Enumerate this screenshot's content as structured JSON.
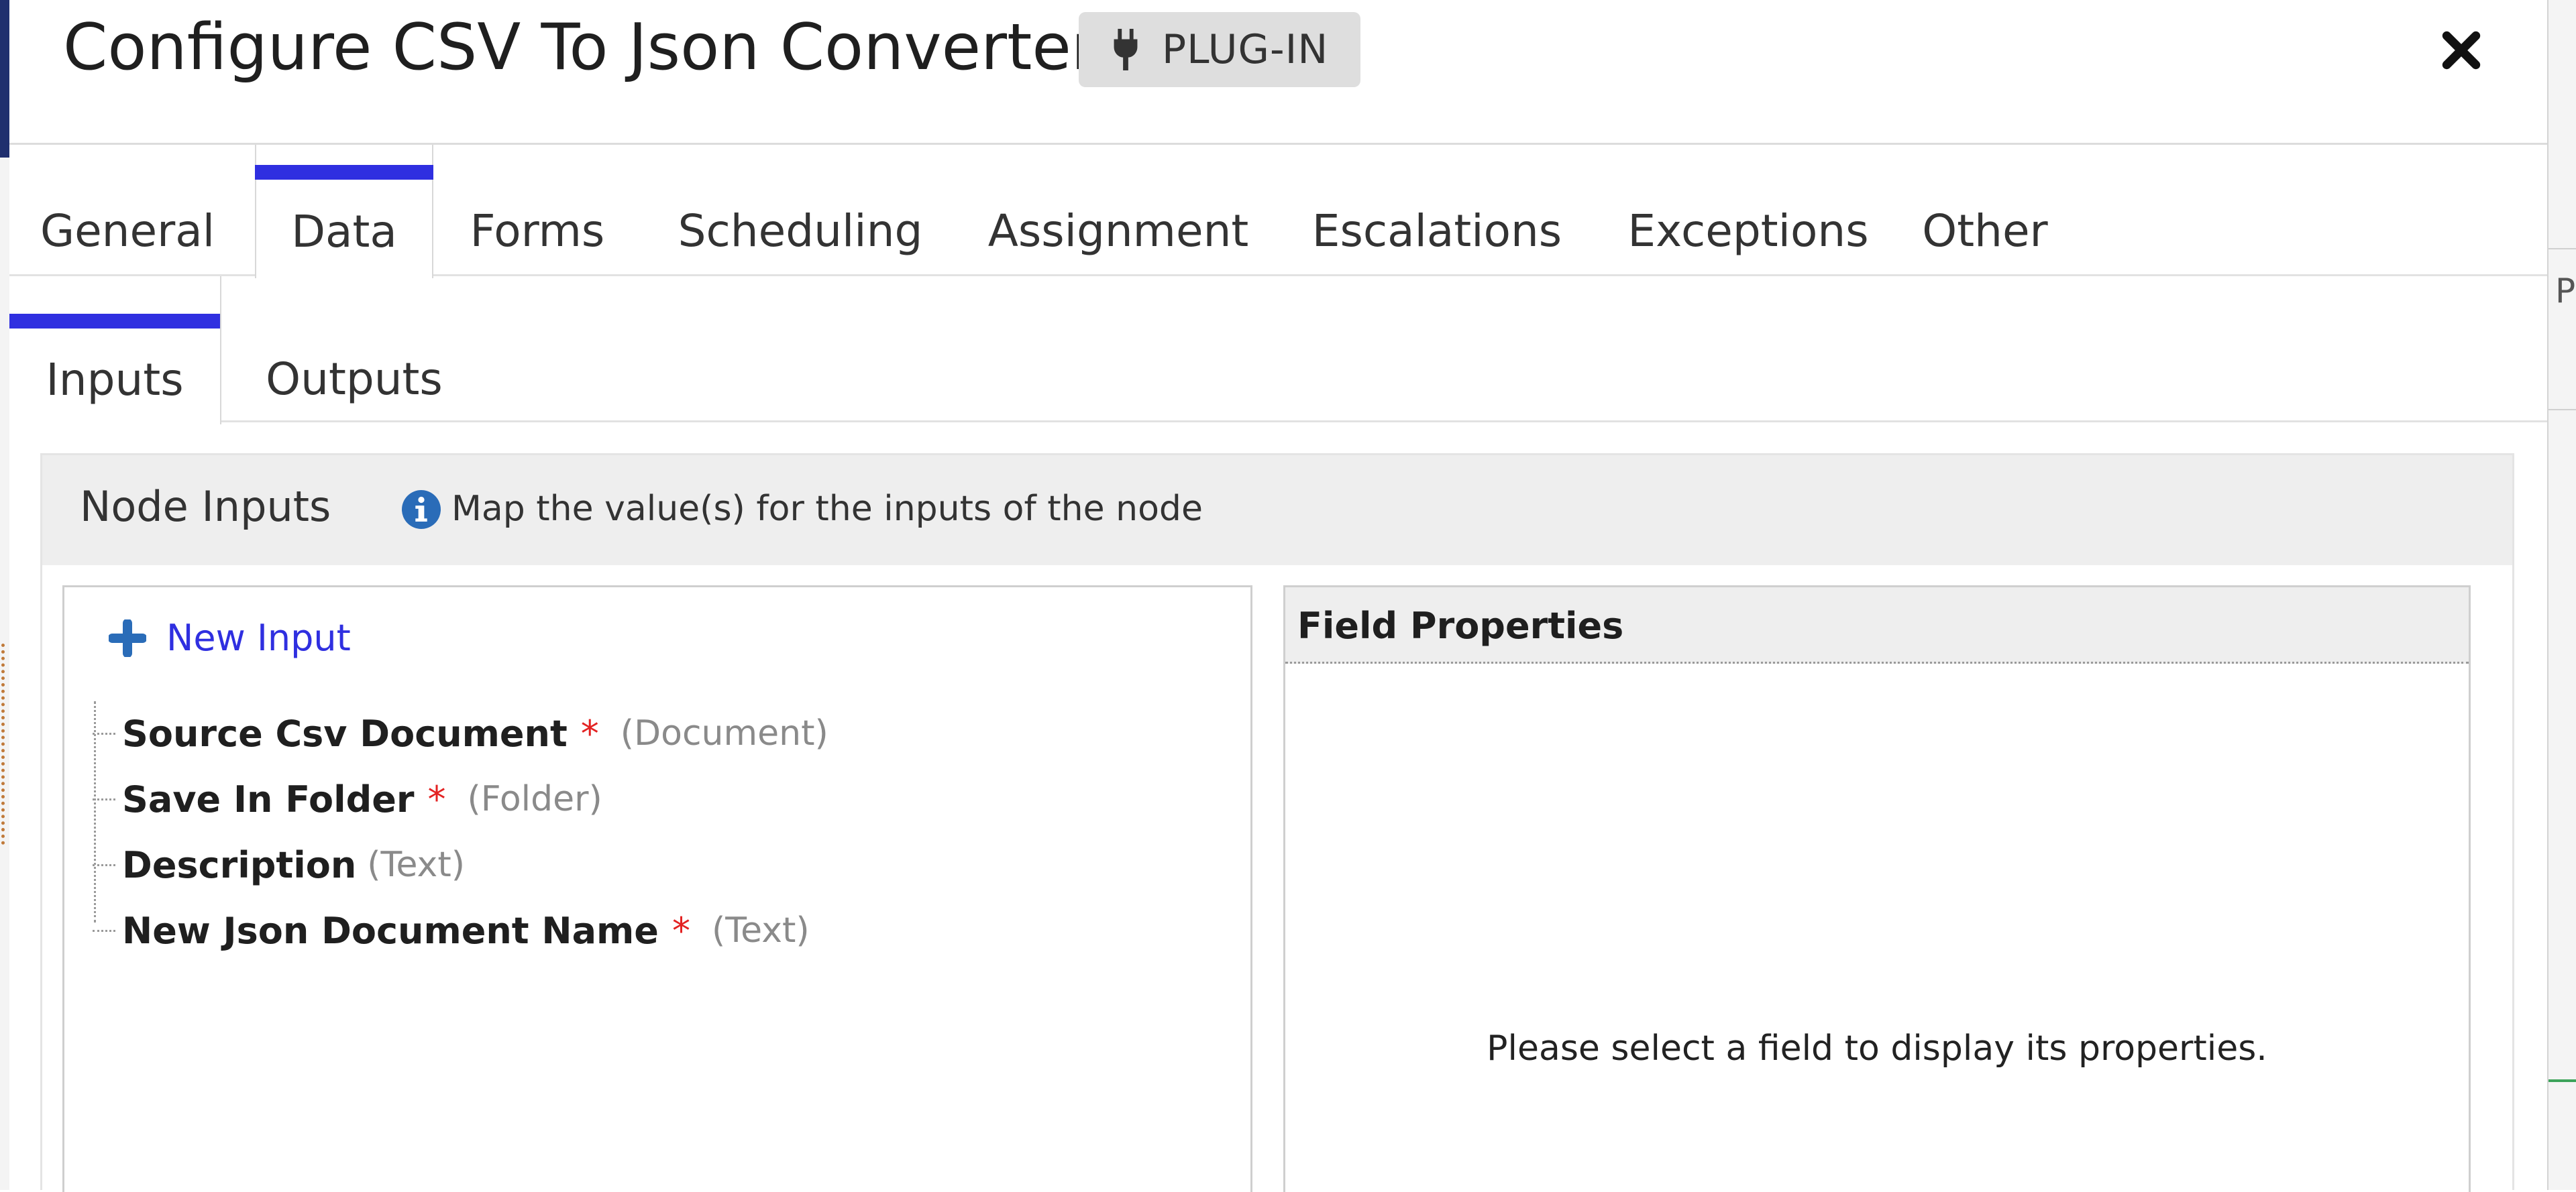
{
  "dialog": {
    "title": "Configure CSV To Json Converter",
    "badge": "PLUG-IN",
    "close_icon": "close-icon"
  },
  "tabs": [
    {
      "label": "General",
      "active": false
    },
    {
      "label": "Data",
      "active": true
    },
    {
      "label": "Forms",
      "active": false
    },
    {
      "label": "Scheduling",
      "active": false
    },
    {
      "label": "Assignment",
      "active": false
    },
    {
      "label": "Escalations",
      "active": false
    },
    {
      "label": "Exceptions",
      "active": false
    },
    {
      "label": "Other",
      "active": false
    }
  ],
  "subtabs": [
    {
      "label": "Inputs",
      "active": true
    },
    {
      "label": "Outputs",
      "active": false
    }
  ],
  "node_inputs": {
    "title": "Node Inputs",
    "info": "Map the value(s) for the inputs of the node",
    "new_input_label": "New Input",
    "items": [
      {
        "name": "Source Csv Document",
        "required": "*",
        "type": "(Document)"
      },
      {
        "name": "Save In Folder",
        "required": "*",
        "type": "(Folder)"
      },
      {
        "name": "Description",
        "required": "",
        "type": "(Text)"
      },
      {
        "name": "New Json Document Name",
        "required": "*",
        "type": "(Text)"
      }
    ]
  },
  "field_properties": {
    "title": "Field Properties",
    "empty_message": "Please select a field to display its properties."
  },
  "background": {
    "partial_text": "Pr"
  },
  "colors": {
    "accent": "#2f2fe0",
    "required": "#e32222",
    "info_icon": "#2a6cb8"
  }
}
